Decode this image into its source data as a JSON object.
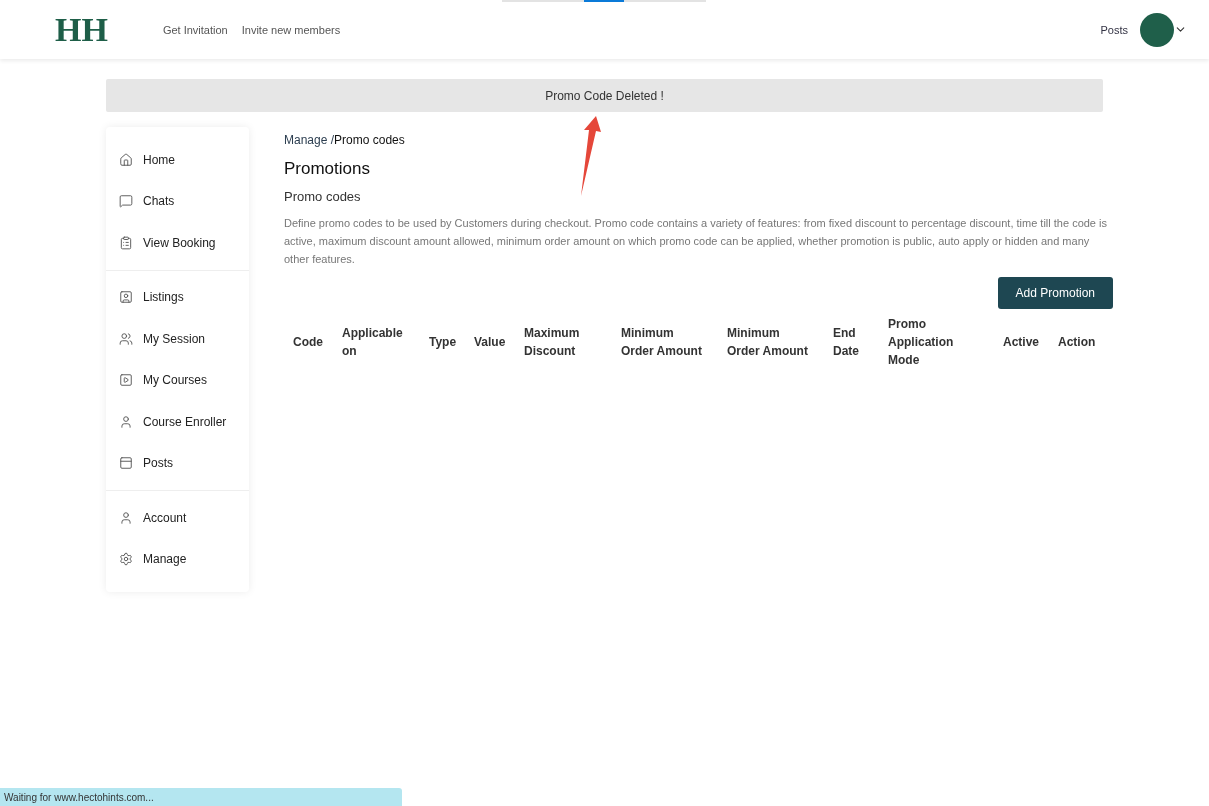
{
  "header": {
    "logo": "HH",
    "nav": [
      "Get Invitation",
      "Invite new members"
    ],
    "right_link": "Posts"
  },
  "toast": {
    "message": "Promo Code Deleted !"
  },
  "sidebar": {
    "groups": [
      [
        "Home",
        "Chats",
        "View Booking"
      ],
      [
        "Listings",
        "My Session",
        "My Courses",
        "Course Enroller",
        "Posts"
      ],
      [
        "Account",
        "Manage"
      ]
    ]
  },
  "breadcrumb": {
    "parent": "Manage /",
    "current": "Promo codes"
  },
  "title": "Promotions",
  "subtitle": "Promo codes",
  "description": "Define promo codes to be used by Customers during checkout. Promo code contains a variety of features: from fixed discount to percentage discount, time till the code is active, maximum discount amount allowed, minimum order amount on which promo code can be applied, whether promotion is public, auto apply or hidden and many other features.",
  "add_button": "Add Promotion",
  "table": {
    "columns": [
      "Code",
      "Applicable on",
      "Type",
      "Value",
      "Maximum Discount",
      "Minimum Order Amount",
      "Minimum Order Amount",
      "End Date",
      "Promo Application Mode",
      "Active",
      "Action"
    ]
  },
  "status_bar": "Waiting for www.hectohints.com..."
}
